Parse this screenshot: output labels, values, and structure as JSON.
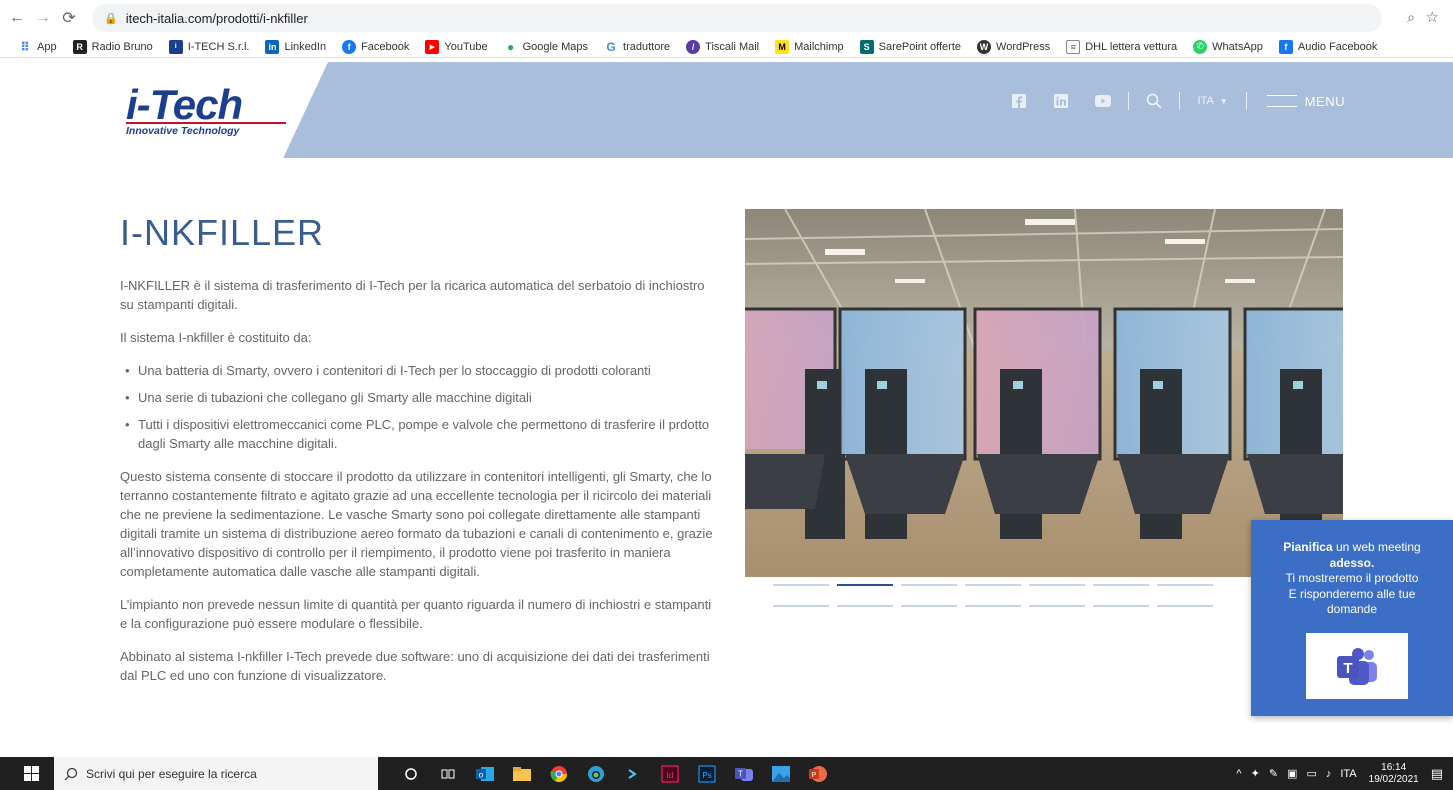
{
  "browser": {
    "url": "itech-italia.com/prodotti/i-nkfiller",
    "bookmarks": [
      "App",
      "Radio Bruno",
      "I-TECH S.r.l.",
      "LinkedIn",
      "Facebook",
      "YouTube",
      "Google Maps",
      "traduttore",
      "Tiscali Mail",
      "Mailchimp",
      "SarePoint offerte",
      "WordPress",
      "DHL lettera vettura",
      "WhatsApp",
      "Audio Facebook"
    ]
  },
  "header": {
    "logo_main": "i-Tech",
    "logo_sub": "Innovative Technology",
    "lang": "ITA",
    "menu_label": "MENU"
  },
  "content": {
    "title": "I-NKFILLER",
    "intro": "I-NKFILLER è il sistema di trasferimento di I-Tech per la ricarica automatica del serbatoio di inchiostro su stampanti digitali.",
    "composed": "Il sistema I-nkfiller è costituito da:",
    "items": [
      "Una batteria di Smarty, ovvero i contenitori di I-Tech per lo stoccaggio di prodotti coloranti",
      "Una serie di tubazioni che collegano gli Smarty alle macchine digitali",
      "Tutti i dispositivi elettromeccanici come PLC, pompe e valvole che permettono di trasferire il prdotto dagli Smarty alle macchine digitali."
    ],
    "para2": "Questo sistema consente di stoccare il prodotto da utilizzare in contenitori intelligenti, gli Smarty, che lo terranno costantemente filtrato e agitato grazie ad una eccellente tecnologia per il ricircolo dei materiali che ne previene la sedimentazione. Le vasche Smarty sono poi collegate direttamente alle stampanti digitali tramite un sistema di distribuzione aereo formato da tubazioni e canali di contenimento e, grazie all’innovativo dispositivo di controllo per il riempimento, il prodotto viene poi trasferito in maniera completamente automatica dalle vasche alle stampanti digitali.",
    "para3": "L’impianto non prevede nessun limite di quantità per quanto riguarda il numero di inchiostri e stampanti e la configurazione può essere modulare o flessibile.",
    "para4": "Abbinato al sistema I-nkfiller I-Tech prevede due software: uno di acquisizione dei dati dei trasferimenti dal PLC ed uno con funzione di visualizzatore."
  },
  "chat": {
    "bold1": "Pianifica",
    "line1": " un web meeting",
    "bold2": "adesso.",
    "line3": "Ti mostreremo il prodotto",
    "line4": "E risponderemo alle tue",
    "line5": "domande"
  },
  "taskbar": {
    "search_placeholder": "Scrivi qui per eseguire la ricerca",
    "lang": "ITA",
    "time": "16:14",
    "date": "19/02/2021"
  }
}
